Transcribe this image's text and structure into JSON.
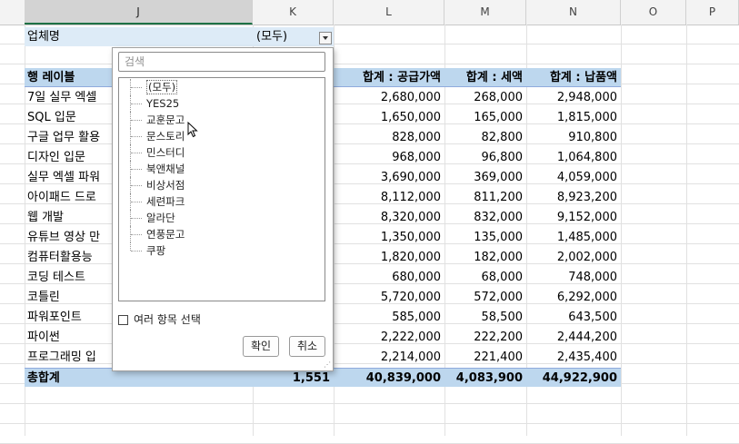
{
  "columns": [
    "J",
    "K",
    "L",
    "M",
    "N",
    "O",
    "P"
  ],
  "filter": {
    "label": "업체명",
    "value": "(모두)"
  },
  "pivot": {
    "row_header": "행 레이블",
    "headers": [
      "합계 : 공급가액",
      "합계 : 세액",
      "합계 : 납품액"
    ],
    "rows": [
      {
        "label": "7일 실무 엑셀",
        "supply": "2,680,000",
        "tax": "268,000",
        "total": "2,948,000"
      },
      {
        "label": "SQL 입문",
        "supply": "1,650,000",
        "tax": "165,000",
        "total": "1,815,000"
      },
      {
        "label": "구글 업무 활용",
        "supply": "828,000",
        "tax": "82,800",
        "total": "910,800"
      },
      {
        "label": "디자인 입문",
        "supply": "968,000",
        "tax": "96,800",
        "total": "1,064,800"
      },
      {
        "label": "실무 엑셀 파워",
        "supply": "3,690,000",
        "tax": "369,000",
        "total": "4,059,000"
      },
      {
        "label": "아이패드 드로",
        "supply": "8,112,000",
        "tax": "811,200",
        "total": "8,923,200"
      },
      {
        "label": "웹 개발",
        "supply": "8,320,000",
        "tax": "832,000",
        "total": "9,152,000"
      },
      {
        "label": "유튜브 영상 만",
        "supply": "1,350,000",
        "tax": "135,000",
        "total": "1,485,000"
      },
      {
        "label": "컴퓨터활용능",
        "supply": "1,820,000",
        "tax": "182,000",
        "total": "2,002,000"
      },
      {
        "label": "코딩 테스트",
        "supply": "680,000",
        "tax": "68,000",
        "total": "748,000"
      },
      {
        "label": "코틀린",
        "supply": "5,720,000",
        "tax": "572,000",
        "total": "6,292,000"
      },
      {
        "label": "파워포인트",
        "supply": "585,000",
        "tax": "58,500",
        "total": "643,500"
      },
      {
        "label": "파이썬",
        "supply": "2,222,000",
        "tax": "222,200",
        "total": "2,444,200"
      },
      {
        "label": "프로그래밍 입",
        "supply": "2,214,000",
        "tax": "221,400",
        "total": "2,435,400"
      }
    ],
    "grand_total": {
      "label": "총합계",
      "count": "1,551",
      "supply": "40,839,000",
      "tax": "4,083,900",
      "total": "44,922,900"
    }
  },
  "dropdown": {
    "search_placeholder": "검색",
    "items": [
      "(모두)",
      "YES25",
      "교훈문고",
      "문스토리",
      "민스터디",
      "북앤채널",
      "비상서점",
      "세련파크",
      "알라단",
      "연풍문고",
      "쿠팡"
    ],
    "multi_select_label": "여러 항목 선택",
    "ok_label": "확인",
    "cancel_label": "취소"
  }
}
